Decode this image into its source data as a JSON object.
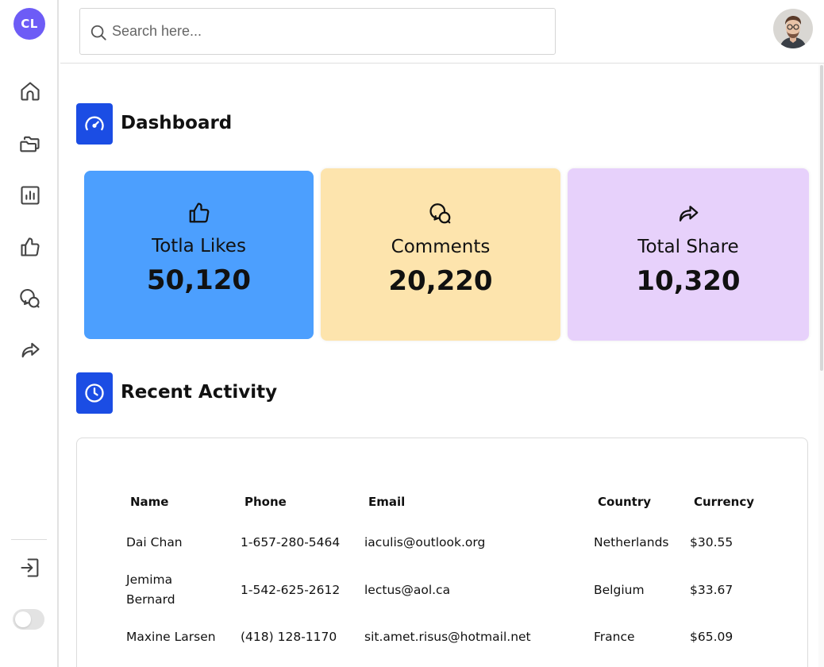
{
  "app": {
    "logo_text": "CL",
    "accent_color": "#1b4de4",
    "logo_color": "#6d5cf6"
  },
  "sidebar": {
    "items": [
      {
        "icon": "home-icon"
      },
      {
        "icon": "folders-icon"
      },
      {
        "icon": "bar-chart-icon"
      },
      {
        "icon": "thumbs-up-icon"
      },
      {
        "icon": "comments-icon"
      },
      {
        "icon": "share-icon"
      }
    ],
    "bottom": [
      {
        "icon": "logout-icon"
      },
      {
        "icon": "theme-toggle"
      }
    ]
  },
  "header": {
    "search": {
      "placeholder": "Search here...",
      "value": ""
    },
    "avatar": "user-avatar"
  },
  "dashboard": {
    "title": "Dashboard",
    "icon": "speedometer-icon",
    "cards": [
      {
        "label": "Totla Likes",
        "value": "50,120",
        "icon": "thumbs-up-icon",
        "color": "#4c9ffe"
      },
      {
        "label": "Comments",
        "value": "20,220",
        "icon": "comments-icon",
        "color": "#fde4ad"
      },
      {
        "label": "Total Share",
        "value": "10,320",
        "icon": "share-icon",
        "color": "#e7d1fb"
      }
    ]
  },
  "activity": {
    "title": "Recent Activity",
    "icon": "clock-icon",
    "columns": [
      "Name",
      "Phone",
      "Email",
      "Country",
      "Currency"
    ],
    "rows": [
      {
        "name": "Dai Chan",
        "phone": "1-657-280-5464",
        "email": "iaculis@outlook.org",
        "country": "Netherlands",
        "currency": "$30.55"
      },
      {
        "name": "Jemima Bernard",
        "name_line1": "Jemima",
        "name_line2": "Bernard",
        "phone": "1-542-625-2612",
        "email": "lectus@aol.ca",
        "country": "Belgium",
        "currency": "$33.67"
      },
      {
        "name": "Maxine Larsen",
        "phone": "(418) 128-1170",
        "email": "sit.amet.risus@hotmail.net",
        "country": "France",
        "currency": "$65.09"
      }
    ]
  }
}
